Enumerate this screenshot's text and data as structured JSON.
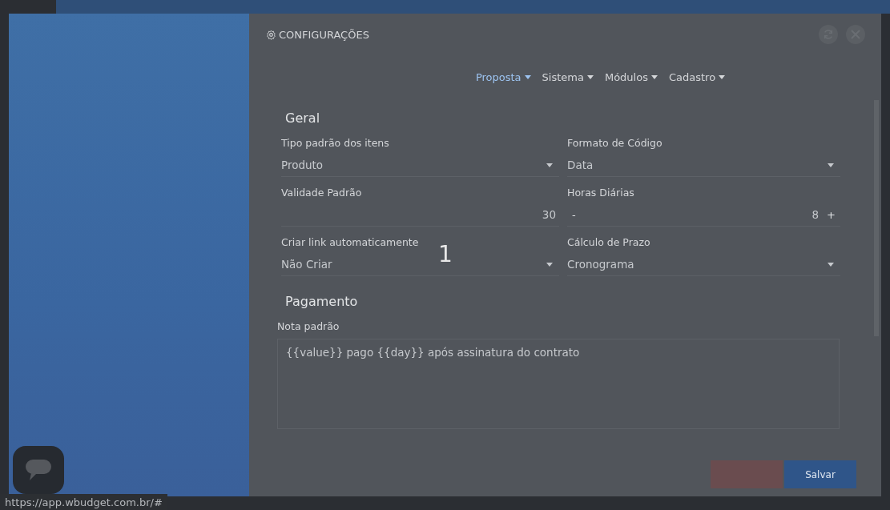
{
  "dialog": {
    "title": "CONFIGURAÇÕES"
  },
  "menu": [
    {
      "label": "Proposta",
      "selected": true
    },
    {
      "label": "Sistema",
      "selected": false
    },
    {
      "label": "Módulos",
      "selected": false
    },
    {
      "label": "Cadastro",
      "selected": false
    }
  ],
  "sections": [
    {
      "heading": "Geral",
      "fields": [
        {
          "kind": "select",
          "label": "Tipo padrão dos itens",
          "value": "Produto"
        },
        {
          "kind": "select",
          "label": "Formato de Código",
          "value": "Data"
        },
        {
          "kind": "number",
          "label": "Validade Padrão",
          "value": "30"
        },
        {
          "kind": "stepper",
          "label": "Horas Diárias",
          "value": "8",
          "minus": "-",
          "plus": "+"
        },
        {
          "kind": "select",
          "label": "Criar link automaticamente",
          "value": "Não Criar"
        },
        {
          "kind": "select",
          "label": "Cálculo de Prazo",
          "value": "Cronograma"
        }
      ]
    },
    {
      "heading": "Pagamento",
      "fields": [
        {
          "kind": "textarea",
          "label": "Nota padrão",
          "value": "{{value}} pago {{day}} após assinatura do contrato"
        }
      ]
    }
  ],
  "overlay_number": "1",
  "buttons": [
    {
      "kind": "danger"
    },
    {
      "kind": "primary",
      "label": "Salvar"
    }
  ],
  "status_url": "https://app.wbudget.com.br/#"
}
